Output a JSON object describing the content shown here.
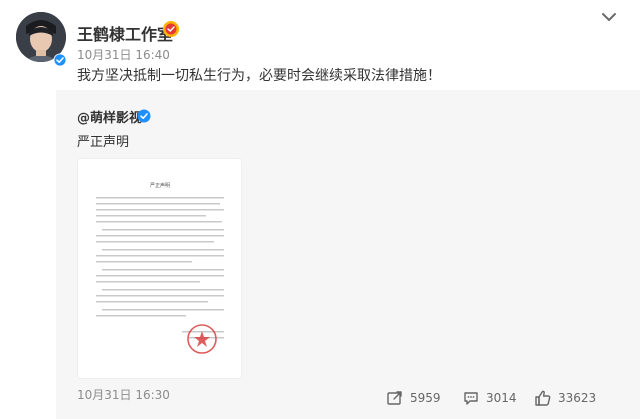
{
  "post": {
    "author": "王鹤棣工作室",
    "time": "10月31日 16:40",
    "text": "我方坚决抵制一切私生行为，必要时会继续采取法律措施！",
    "icons": {
      "avatar": "avatar",
      "verified": "verified-icon",
      "rank": "rank-badge-icon",
      "more": "chevron-down-icon"
    }
  },
  "repost": {
    "author": "@萌样影视",
    "text": "严正声明",
    "time": "10月31日 16:30",
    "attachment": {
      "type": "document-image",
      "heading": "严正声明"
    }
  },
  "actions": {
    "repost_count": "5959",
    "comment_count": "3014",
    "like_count": "33623",
    "icons": [
      "repost-icon",
      "comment-icon",
      "like-icon"
    ]
  },
  "colors": {
    "text": "#333333",
    "muted": "#8c8c8c",
    "repost_bg": "#f6f6f6",
    "verified": "#1e90ff",
    "rank_badge": "#ffb300",
    "seal": "#d94141"
  }
}
